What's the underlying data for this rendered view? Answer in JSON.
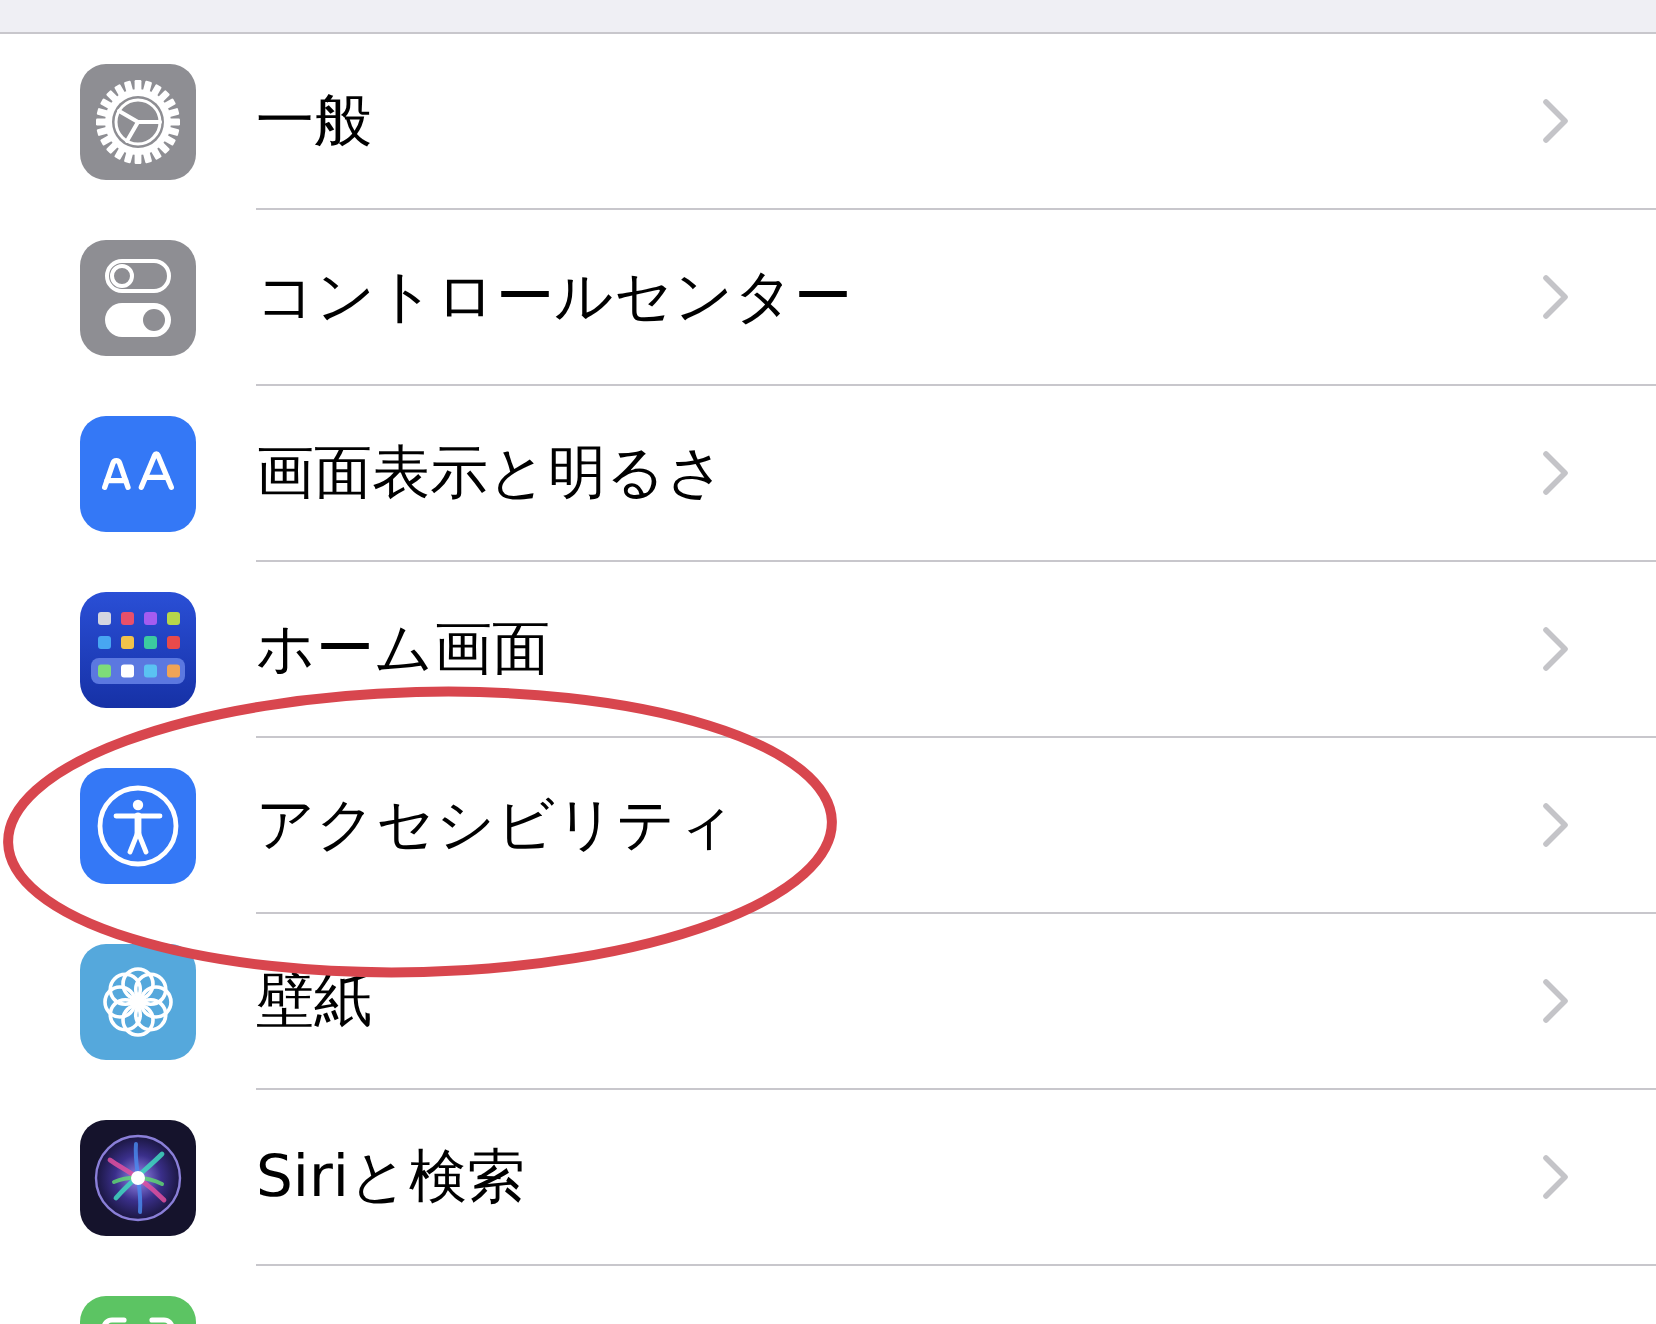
{
  "settings_rows": [
    {
      "kind": "gear",
      "label": "一般",
      "circled": false
    },
    {
      "kind": "toggles",
      "label": "コントロールセンター",
      "circled": false
    },
    {
      "kind": "text-size",
      "label": "画面表示と明るさ",
      "circled": false
    },
    {
      "kind": "home-grid",
      "label": "ホーム画面",
      "circled": false
    },
    {
      "kind": "accessibility",
      "label": "アクセシビリティ",
      "circled": true
    },
    {
      "kind": "flower",
      "label": "壁紙",
      "circled": false
    },
    {
      "kind": "siri",
      "label": "Siriと検索",
      "circled": false
    },
    {
      "kind": "face-scan",
      "circled": false
    }
  ]
}
